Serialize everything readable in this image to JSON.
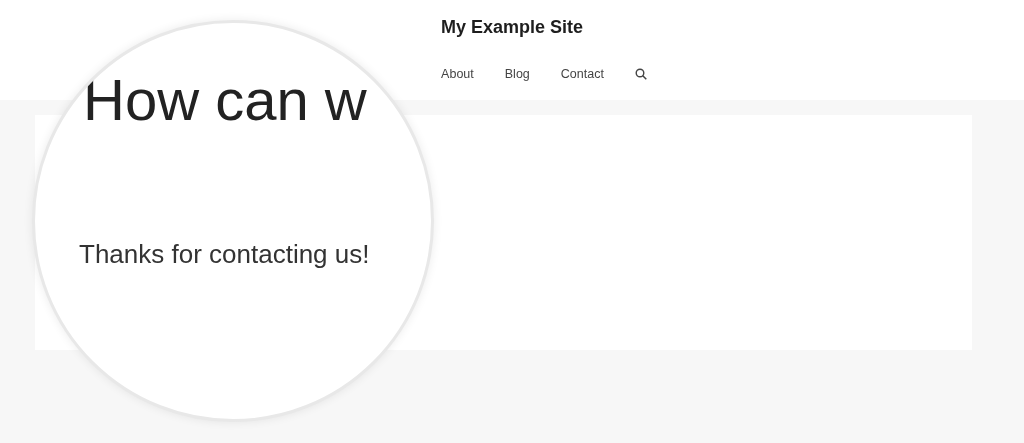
{
  "site_title": "My Example Site",
  "nav": [
    {
      "label": "About"
    },
    {
      "label": "Blog"
    },
    {
      "label": "Contact"
    }
  ],
  "magnifier": {
    "heading": "How can w",
    "message": "Thanks for contacting us!"
  }
}
